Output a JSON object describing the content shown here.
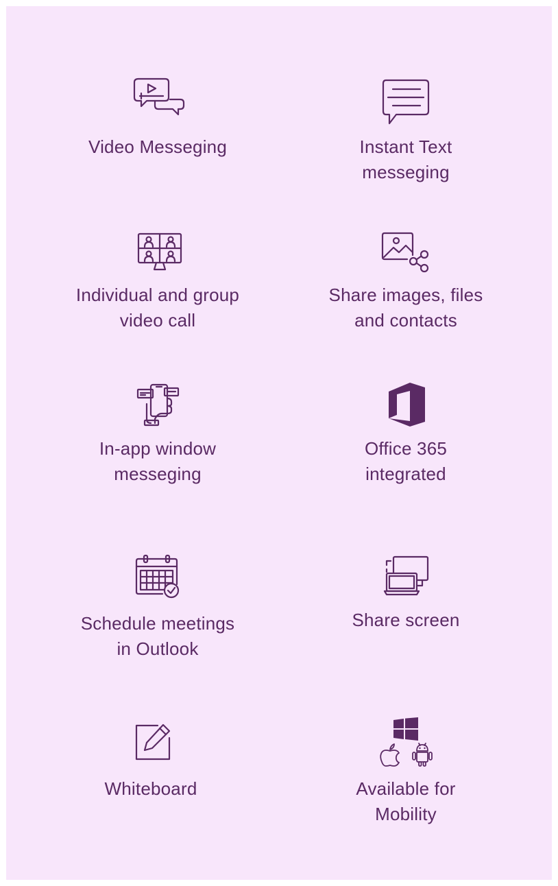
{
  "theme": {
    "background": "#f8e6fb",
    "accent": "#5a2a64"
  },
  "features": [
    {
      "label": "Video Messeging",
      "icon": "video-message-icon"
    },
    {
      "label": "Instant Text\nmesseging",
      "icon": "chat-text-icon"
    },
    {
      "label": "Individual and group\nvideo call",
      "icon": "group-video-call-icon"
    },
    {
      "label": "Share images, files\nand contacts",
      "icon": "share-image-icon"
    },
    {
      "label": "In-app window\nmesseging",
      "icon": "in-app-messaging-icon"
    },
    {
      "label": "Office 365\nintegrated",
      "icon": "office-365-icon"
    },
    {
      "label": "Schedule meetings\nin Outlook",
      "icon": "calendar-check-icon"
    },
    {
      "label": "Share screen",
      "icon": "share-screen-icon"
    },
    {
      "label": "Whiteboard",
      "icon": "whiteboard-icon"
    },
    {
      "label": "Available for\nMobility",
      "icon": "platforms-icon"
    }
  ]
}
